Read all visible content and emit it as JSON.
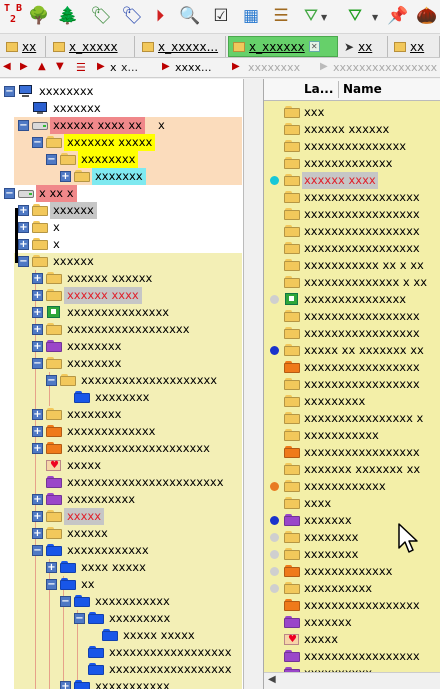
{
  "toolbar": {
    "logo_text": "T B\n2",
    "buttons": [
      {
        "name": "tree-green-icon"
      },
      {
        "name": "tree-outline-icon"
      },
      {
        "name": "tag-icon"
      },
      {
        "name": "tag-blue-icon"
      },
      {
        "name": "forward-circle-icon"
      },
      {
        "name": "magnifier-icon"
      },
      {
        "name": "checkbox-icon"
      },
      {
        "name": "grid-icon"
      },
      {
        "name": "list-icon"
      },
      {
        "name": "filter-outline-icon"
      },
      {
        "name": "filter-green-icon"
      },
      {
        "name": "pin-add-icon"
      },
      {
        "name": "nut-icon"
      }
    ]
  },
  "tabs": [
    {
      "label": "xx"
    },
    {
      "label": "x_xxxxx"
    },
    {
      "label": "x_xxxxx..."
    },
    {
      "label": "x_xxxxxx",
      "active": true
    },
    {
      "label": "xx"
    },
    {
      "label": "xx"
    }
  ],
  "breadcrumb": {
    "segments": [
      "x",
      "x...",
      "xxxx...",
      "xxxxxxxx",
      "xxxxxxxxxxxxxxxx"
    ]
  },
  "tree": [
    {
      "depth": 0,
      "text": "xxxxxxxx",
      "icon": "computer-icon",
      "expander": "minus"
    },
    {
      "depth": 1,
      "text": "xxxxxxx",
      "icon": "monitor-icon",
      "expander": "none"
    },
    {
      "depth": 1,
      "text": "xxxxxx xxxx xx",
      "suffix": "x",
      "icon": "drive-icon",
      "expander": "minus",
      "hl": "red"
    },
    {
      "depth": 2,
      "text": "xxxxxxx xxxxx",
      "icon": "folder",
      "expander": "minus",
      "hl": "yellow"
    },
    {
      "depth": 3,
      "text": "xxxxxxxx",
      "icon": "folder",
      "expander": "minus",
      "hl": "yellow"
    },
    {
      "depth": 4,
      "text": "xxxxxxx",
      "icon": "folder",
      "expander": "plus",
      "hl": "cyan"
    },
    {
      "depth": 0,
      "text": "x  xx x",
      "icon": "drive-icon",
      "expander": "minus",
      "hl": "red"
    },
    {
      "depth": 1,
      "text": "xxxxxx",
      "icon": "folder",
      "expander": "plus",
      "hl": "gray"
    },
    {
      "depth": 1,
      "text": "x",
      "icon": "folder",
      "expander": "plus"
    },
    {
      "depth": 1,
      "text": "x",
      "icon": "folder",
      "expander": "plus"
    },
    {
      "depth": 1,
      "text": "xxxxxx",
      "icon": "folder",
      "expander": "minus"
    },
    {
      "depth": 2,
      "text": "xxxxxx xxxxxx",
      "icon": "folder",
      "expander": "plus"
    },
    {
      "depth": 2,
      "text": "xxxxxx xxxx",
      "icon": "folder",
      "expander": "plus",
      "hl": "grayred"
    },
    {
      "depth": 2,
      "text": "xxxxxxxxxxxxxxx",
      "icon": "green-box",
      "expander": "plus"
    },
    {
      "depth": 2,
      "text": "xxxxxxxxxxxxxxxxxx",
      "icon": "folder",
      "expander": "plus"
    },
    {
      "depth": 2,
      "text": "xxxxxxxx",
      "icon": "purple",
      "expander": "plus"
    },
    {
      "depth": 2,
      "text": "xxxxxxxx",
      "icon": "folder",
      "expander": "minus"
    },
    {
      "depth": 3,
      "text": "xxxxxxxxxxxxxxxxxxxx",
      "icon": "folder",
      "expander": "minus"
    },
    {
      "depth": 4,
      "text": "xxxxxxxx",
      "icon": "blue",
      "expander": "none"
    },
    {
      "depth": 2,
      "text": "xxxxxxxx",
      "icon": "folder",
      "expander": "plus"
    },
    {
      "depth": 2,
      "text": "xxxxxxxxxxxxx",
      "icon": "orange",
      "expander": "plus"
    },
    {
      "depth": 2,
      "text": "xxxxxxxxxxxxxxxxxxxxx",
      "icon": "orange",
      "expander": "plus"
    },
    {
      "depth": 2,
      "text": "xxxxx",
      "icon": "heart",
      "expander": "none"
    },
    {
      "depth": 2,
      "text": "xxxxxxxxxxxxxxxxxxxxxxx",
      "icon": "purple",
      "expander": "none"
    },
    {
      "depth": 2,
      "text": "xxxxxxxxxx",
      "icon": "purple",
      "expander": "plus"
    },
    {
      "depth": 2,
      "text": "xxxxx",
      "icon": "folder",
      "expander": "plus",
      "hl": "grayred"
    },
    {
      "depth": 2,
      "text": "xxxxxx",
      "icon": "folder",
      "expander": "plus"
    },
    {
      "depth": 2,
      "text": "xxxxxxxxxxxx",
      "icon": "blue",
      "expander": "minus"
    },
    {
      "depth": 3,
      "text": "xxxx xxxxx",
      "icon": "blue",
      "expander": "plus"
    },
    {
      "depth": 3,
      "text": "xx",
      "icon": "blue",
      "expander": "minus"
    },
    {
      "depth": 4,
      "text": "xxxxxxxxxxx",
      "icon": "blue",
      "expander": "minus"
    },
    {
      "depth": 5,
      "text": "xxxxxxxxx",
      "icon": "blue",
      "expander": "minus"
    },
    {
      "depth": 6,
      "text": "xxxxx xxxxx",
      "icon": "blue",
      "expander": "none"
    },
    {
      "depth": 5,
      "text": "xxxxxxxxxxxxxxxxxx",
      "icon": "blue",
      "expander": "none"
    },
    {
      "depth": 5,
      "text": "xxxxxxxxxxxxxxxxxx",
      "icon": "blue",
      "expander": "none"
    },
    {
      "depth": 4,
      "text": "xxxxxxxxxxx",
      "icon": "blue",
      "expander": "plus"
    }
  ],
  "list": {
    "col_label": "La...",
    "col_name": "Name",
    "rows": [
      {
        "text": "xxx",
        "icon": "folder"
      },
      {
        "text": "xxxxxx xxxxxx",
        "icon": "folder"
      },
      {
        "text": "xxxxxxxxxxxxxxx",
        "icon": "folder"
      },
      {
        "text": "xxxxxxxxxxxxx",
        "icon": "folder"
      },
      {
        "text": "xxxxxx xxxx",
        "icon": "folder",
        "hl": "grayred",
        "dot": "#17c8d8"
      },
      {
        "text": "xxxxxxxxxxxxxxxxx",
        "icon": "folder"
      },
      {
        "text": "xxxxxxxxxxxxxxxxx",
        "icon": "folder"
      },
      {
        "text": "xxxxxxxxxxxxxxxxx",
        "icon": "folder"
      },
      {
        "text": "xxxxxxxxxxxxxxxxx",
        "icon": "folder"
      },
      {
        "text": "xxxxxxxxxxx xx x xx",
        "icon": "folder"
      },
      {
        "text": "xxxxxxxxxxxxxx x xx",
        "icon": "folder"
      },
      {
        "text": "xxxxxxxxxxxxxxx",
        "icon": "green-box",
        "dot": "#cfcfcf"
      },
      {
        "text": "xxxxxxxxxxxxxxxxx",
        "icon": "folder"
      },
      {
        "text": "xxxxxxxxxxxxxxxxx",
        "icon": "folder"
      },
      {
        "text": "xxxxx xx xxxxxxx xx",
        "icon": "folder",
        "dot": "#1a33cc"
      },
      {
        "text": "xxxxxxxxxxxxxxxxx",
        "icon": "orange"
      },
      {
        "text": "xxxxxxxxxxxxxxxxx",
        "icon": "folder"
      },
      {
        "text": "xxxxxxxxx",
        "icon": "folder"
      },
      {
        "text": "xxxxxxxxxxxxxxxx x",
        "icon": "folder"
      },
      {
        "text": "xxxxxxxxxxx",
        "icon": "folder"
      },
      {
        "text": "xxxxxxxxxxxxxxxxx",
        "icon": "orange"
      },
      {
        "text": "xxxxxxx xxxxxxx xx",
        "icon": "folder"
      },
      {
        "text": "xxxxxxxxxxxx",
        "icon": "folder",
        "dot": "#e87b22"
      },
      {
        "text": "xxxx",
        "icon": "folder"
      },
      {
        "text": "xxxxxxx",
        "icon": "purple",
        "dot": "#1a33cc"
      },
      {
        "text": "xxxxxxxx",
        "icon": "folder",
        "dot": "#cfcfcf"
      },
      {
        "text": "xxxxxxxx",
        "icon": "folder",
        "dot": "#cfcfcf"
      },
      {
        "text": "xxxxxxxxxxxxx",
        "icon": "orange",
        "dot": "#cfcfcf"
      },
      {
        "text": "xxxxxxxxxx",
        "icon": "folder",
        "dot": "#cfcfcf"
      },
      {
        "text": "xxxxxxxxxxxxxxxxx",
        "icon": "orange"
      },
      {
        "text": "xxxxxxx",
        "icon": "purple"
      },
      {
        "text": "xxxxx",
        "icon": "heart"
      },
      {
        "text": "xxxxxxxxxxxxxxxxx",
        "icon": "purple"
      },
      {
        "text": "xxxxxxxxxx",
        "icon": "purple"
      }
    ]
  },
  "colors": {
    "hl_red": "#f0888a",
    "hl_yellow": "#ffff00",
    "hl_cyan": "#7fe9f0",
    "hl_gray": "#c6c6c6",
    "hl_grayred_text": "#e0202a",
    "region_peach": "#fbdcbc",
    "region_khaki": "#f3efb6",
    "folder": "#f2c85b",
    "blue": "#1856e8",
    "orange": "#ef7a1a",
    "purple": "#9a46c9",
    "green": "#2ea63a"
  }
}
